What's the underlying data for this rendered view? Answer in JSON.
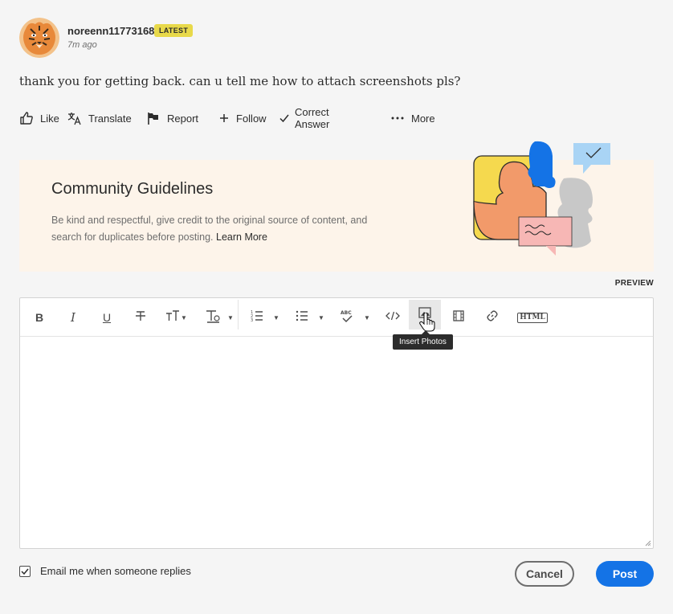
{
  "post": {
    "username": "noreenn11773168",
    "badge": "LATEST",
    "timestamp": "7m ago",
    "message": "thank you for getting back.  can u tell me how to attach screenshots pls?"
  },
  "actions": {
    "like": "Like",
    "translate": "Translate",
    "report": "Report",
    "follow": "Follow",
    "correct_answer": "Correct Answer",
    "more": "More"
  },
  "guidelines": {
    "title": "Community Guidelines",
    "text": "Be kind and respectful, give credit to the original source of content, and search for duplicates before posting.",
    "link": "Learn More"
  },
  "editor": {
    "preview_label": "PREVIEW",
    "tooltip": "Insert Photos",
    "html_label": "HTML"
  },
  "footer": {
    "email_option": "Email me when someone replies",
    "email_checked": true,
    "cancel": "Cancel",
    "post": "Post"
  },
  "colors": {
    "accent": "#1473e6",
    "badge": "#e8d94a",
    "guidelines_bg": "#fdf4ea"
  }
}
